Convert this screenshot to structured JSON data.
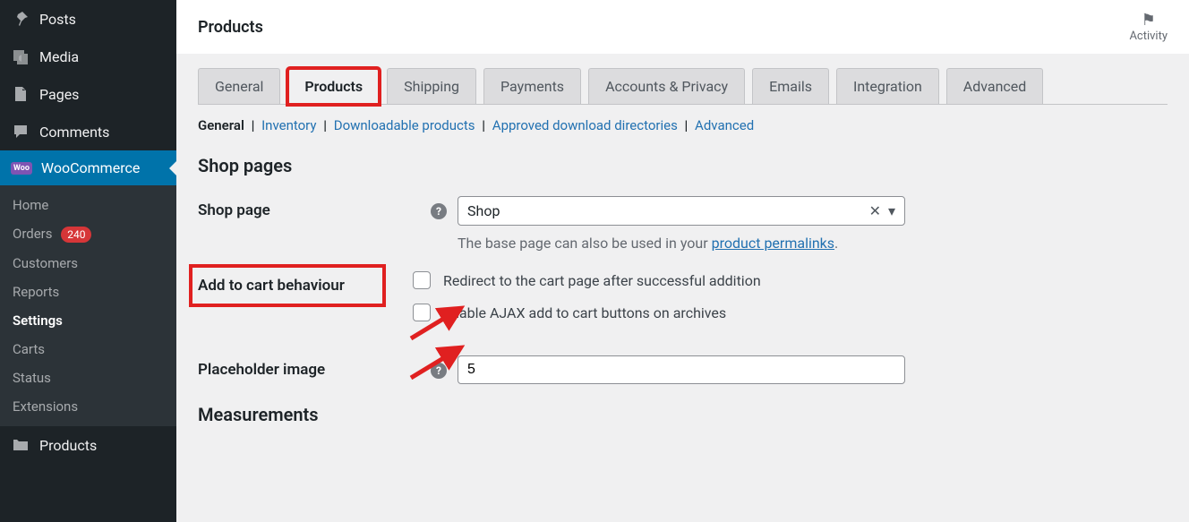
{
  "sidebar": {
    "items": [
      {
        "label": "Posts",
        "icon": "pin"
      },
      {
        "label": "Media",
        "icon": "media"
      },
      {
        "label": "Pages",
        "icon": "pages"
      },
      {
        "label": "Comments",
        "icon": "comment"
      }
    ],
    "woocommerce_label": "WooCommerce",
    "sub_items": [
      {
        "label": "Home"
      },
      {
        "label": "Orders",
        "badge": "240"
      },
      {
        "label": "Customers"
      },
      {
        "label": "Reports"
      },
      {
        "label": "Settings",
        "current": true
      },
      {
        "label": "Carts"
      },
      {
        "label": "Status"
      },
      {
        "label": "Extensions"
      }
    ],
    "products_label": "Products"
  },
  "topbar": {
    "title": "Products",
    "activity_label": "Activity"
  },
  "tabs": [
    {
      "label": "General"
    },
    {
      "label": "Products",
      "active": true,
      "highlighted": true
    },
    {
      "label": "Shipping"
    },
    {
      "label": "Payments"
    },
    {
      "label": "Accounts & Privacy"
    },
    {
      "label": "Emails"
    },
    {
      "label": "Integration"
    },
    {
      "label": "Advanced"
    }
  ],
  "sub_links": {
    "current": "General",
    "links": [
      "Inventory",
      "Downloadable products",
      "Approved download directories",
      "Advanced"
    ]
  },
  "sections": {
    "shop_pages_heading": "Shop pages",
    "measurements_heading": "Measurements"
  },
  "shop_page": {
    "label": "Shop page",
    "value": "Shop",
    "hint_prefix": "The base page can also be used in your ",
    "hint_link": "product permalinks",
    "hint_suffix": "."
  },
  "cart_behaviour": {
    "label": "Add to cart behaviour",
    "opt1": "Redirect to the cart page after successful addition",
    "opt2": "Enable AJAX add to cart buttons on archives"
  },
  "placeholder_image": {
    "label": "Placeholder image",
    "value": "5"
  },
  "annotations": {
    "highlight_color": "#e02020"
  }
}
